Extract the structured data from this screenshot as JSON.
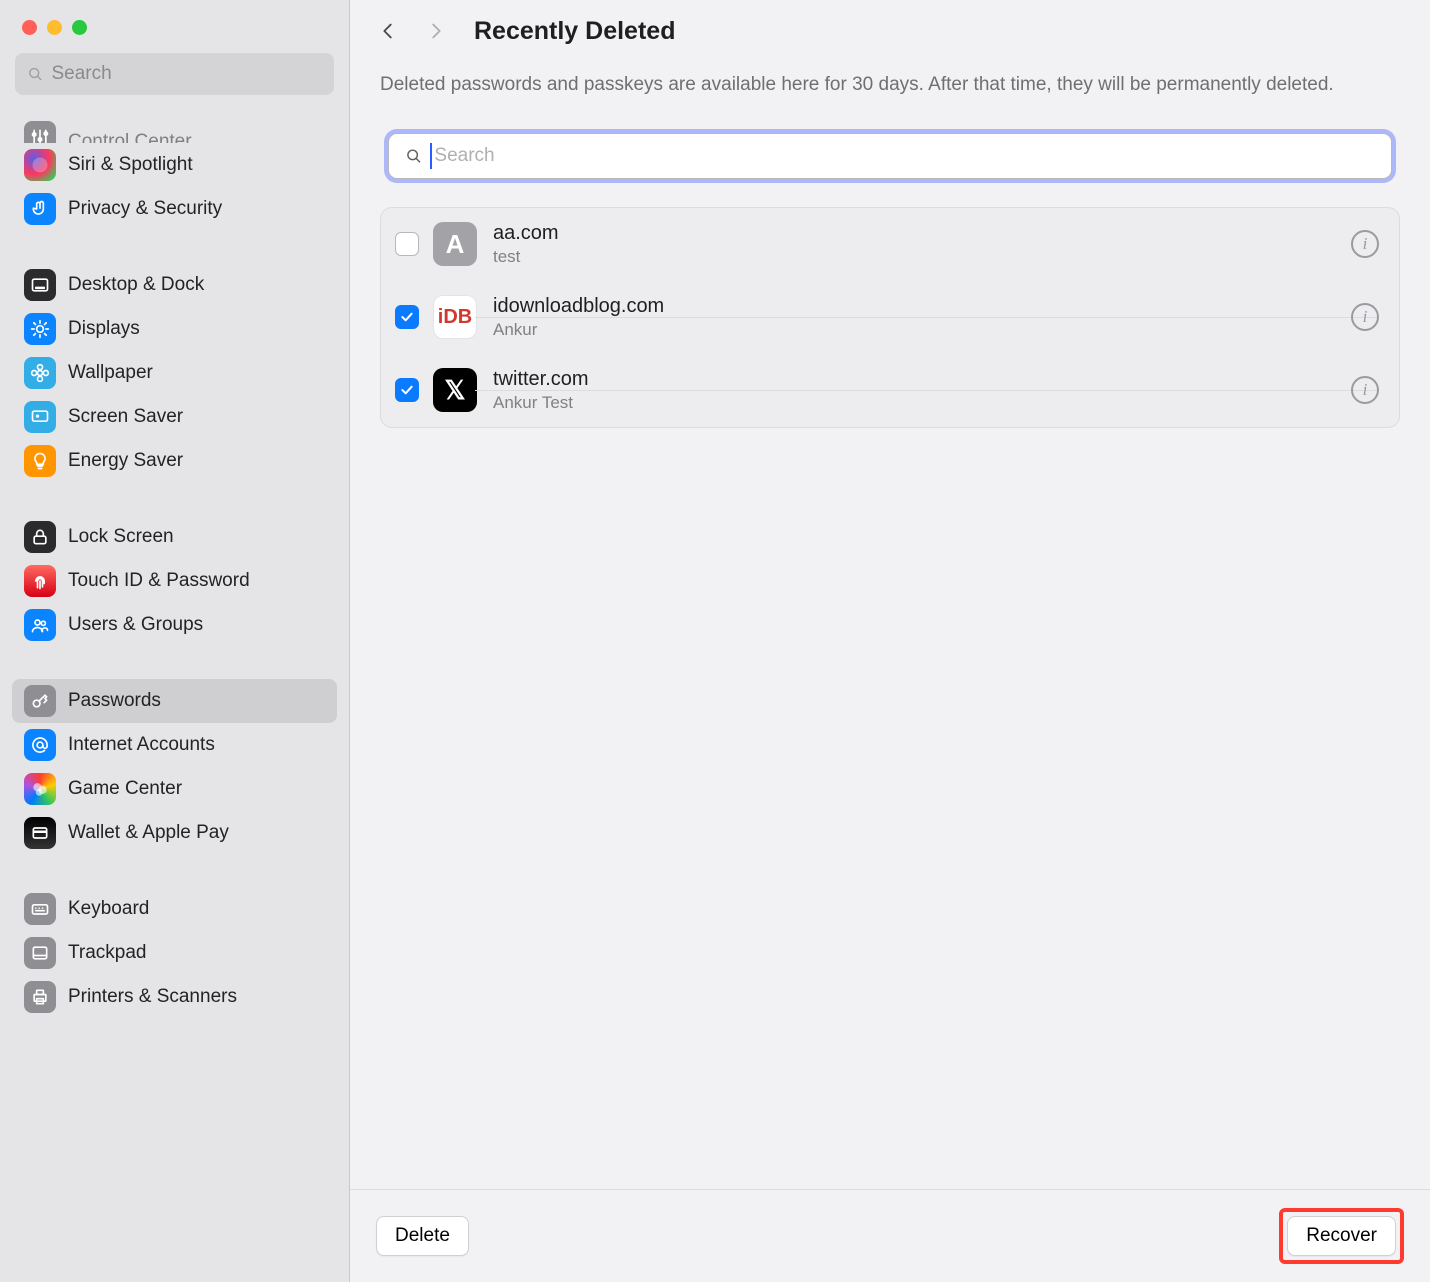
{
  "window": {
    "search_placeholder": "Search"
  },
  "sidebar": {
    "items": [
      {
        "label": "Control Center",
        "icon": "sliders",
        "color": "ic-grey",
        "partial_top": true
      },
      {
        "label": "Siri & Spotlight",
        "icon": "siri",
        "color": "ic-siri"
      },
      {
        "label": "Privacy & Security",
        "icon": "hand",
        "color": "ic-blue"
      },
      {
        "label": "Desktop & Dock",
        "icon": "dock",
        "color": "ic-dark"
      },
      {
        "label": "Displays",
        "icon": "sun",
        "color": "ic-blue"
      },
      {
        "label": "Wallpaper",
        "icon": "flower",
        "color": "ic-cyan"
      },
      {
        "label": "Screen Saver",
        "icon": "screensaver",
        "color": "ic-cyan"
      },
      {
        "label": "Energy Saver",
        "icon": "bulb",
        "color": "ic-orange"
      },
      {
        "label": "Lock Screen",
        "icon": "lock",
        "color": "ic-dark"
      },
      {
        "label": "Touch ID & Password",
        "icon": "fingerprint",
        "color": "ic-red"
      },
      {
        "label": "Users & Groups",
        "icon": "users",
        "color": "ic-blue"
      },
      {
        "label": "Passwords",
        "icon": "key",
        "color": "ic-grey",
        "selected": true
      },
      {
        "label": "Internet Accounts",
        "icon": "at",
        "color": "ic-blue"
      },
      {
        "label": "Game Center",
        "icon": "gamecenter",
        "color": "ic-multi"
      },
      {
        "label": "Wallet & Apple Pay",
        "icon": "wallet",
        "color": "ic-wallet"
      },
      {
        "label": "Keyboard",
        "icon": "keyboard",
        "color": "ic-grey"
      },
      {
        "label": "Trackpad",
        "icon": "trackpad",
        "color": "ic-grey"
      },
      {
        "label": "Printers & Scanners",
        "icon": "printer",
        "color": "ic-grey"
      }
    ],
    "groups_after": [
      2,
      7,
      10,
      14
    ]
  },
  "header": {
    "title": "Recently Deleted",
    "back_enabled": true,
    "forward_enabled": false
  },
  "description": "Deleted passwords and passkeys are available here for 30 days. After that time, they will be permanently deleted.",
  "search": {
    "placeholder": "Search",
    "value": ""
  },
  "passwords": [
    {
      "site": "aa.com",
      "user": "test",
      "checked": false,
      "favicon_text": "A",
      "favicon_class": "fav-grey"
    },
    {
      "site": "idownloadblog.com",
      "user": "Ankur",
      "checked": true,
      "favicon_text": "iDB",
      "favicon_class": "fav-idb"
    },
    {
      "site": "twitter.com",
      "user": "Ankur Test",
      "checked": true,
      "favicon_text": "𝕏",
      "favicon_class": "fav-x"
    }
  ],
  "footer": {
    "delete_label": "Delete",
    "recover_label": "Recover"
  }
}
